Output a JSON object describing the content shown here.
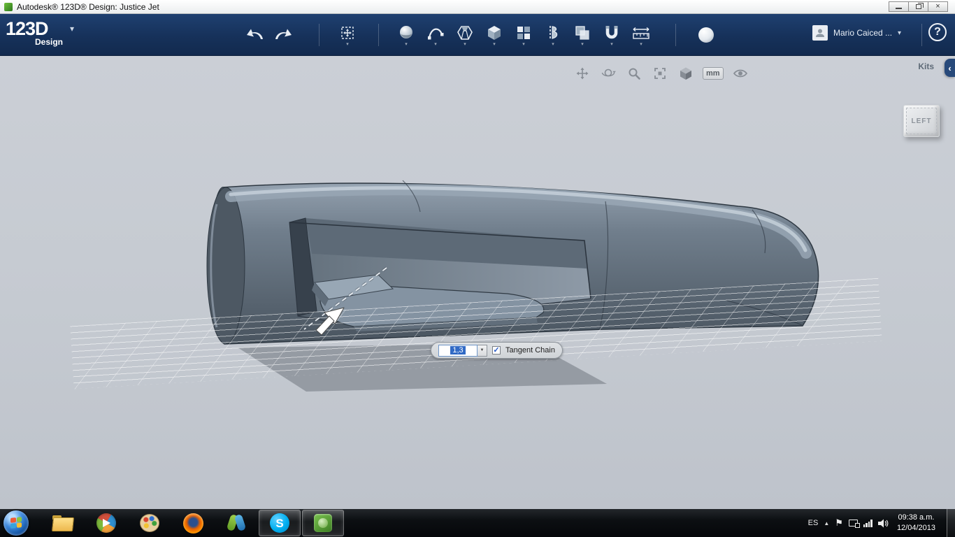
{
  "window": {
    "title": "Autodesk® 123D® Design: Justice Jet",
    "controls": {
      "close": "×"
    }
  },
  "app_toolbar": {
    "brand": "123D",
    "brand_sub": "Design",
    "caret": "▾",
    "tool_names": [
      "undo",
      "redo",
      "transform",
      "primitives",
      "sketch",
      "chamfer",
      "extrude",
      "pattern",
      "revolve",
      "combine",
      "snap",
      "measure",
      "material"
    ],
    "account": {
      "name": "Mario Caiced ...",
      "caret": "▾",
      "help": "?"
    }
  },
  "viewport": {
    "nav_tool_names": [
      "pan",
      "orbit",
      "zoom",
      "fit",
      "shaded-cube",
      "units",
      "visibility"
    ],
    "units_label": "mm",
    "kits_label": "Kits",
    "kits_chevron": "‹",
    "viewcube_label": "LEFT",
    "mini_toolbar": {
      "value": "1,3",
      "dropdown_glyph": "▼",
      "check_glyph": "✓",
      "checkbox_label": "Tangent Chain",
      "checked": true
    }
  },
  "taskbar": {
    "app_names": [
      "start",
      "explorer",
      "media-player",
      "gallery",
      "firefox",
      "messenger",
      "skype",
      "design-app"
    ],
    "skype_letter": "S",
    "tray": {
      "lang": "ES",
      "expand": "▲",
      "flag": "⚑",
      "time": "09:38 a.m.",
      "date": "12/04/2013"
    }
  }
}
